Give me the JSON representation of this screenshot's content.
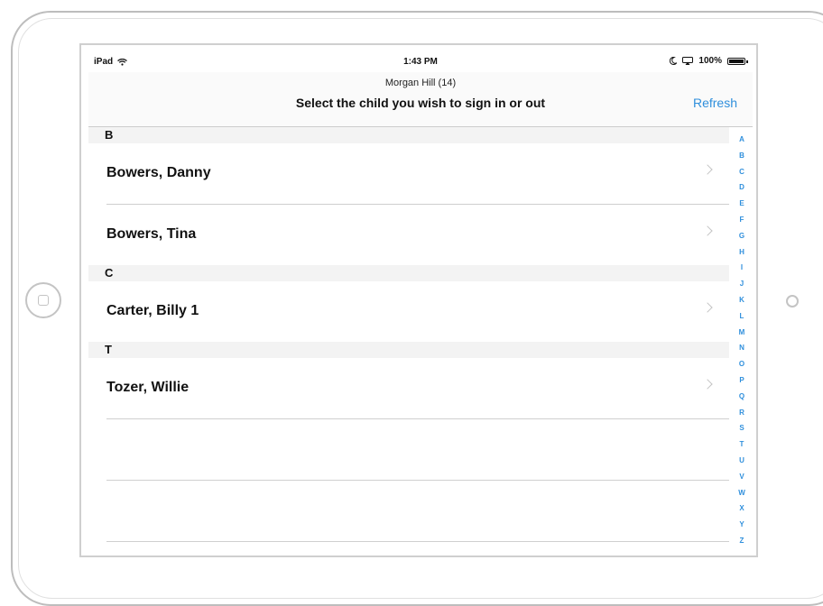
{
  "statusbar": {
    "device": "iPad",
    "wifi_icon": "wifi-icon",
    "time": "1:43 PM",
    "moon_icon": "moon-icon",
    "airplay_icon": "airplay-icon",
    "battery_text": "100%",
    "battery_level": 1.0
  },
  "navbar": {
    "subtitle": "Morgan Hill (14)",
    "title": "Select the child you wish to sign in or out",
    "refresh_label": "Refresh"
  },
  "sections": [
    {
      "letter": "B",
      "items": [
        {
          "name": "Bowers, Danny"
        },
        {
          "name": "Bowers, Tina"
        }
      ]
    },
    {
      "letter": "C",
      "items": [
        {
          "name": "Carter, Billy 1"
        }
      ]
    },
    {
      "letter": "T",
      "items": [
        {
          "name": "Tozer, Willie"
        }
      ]
    }
  ],
  "index_letters": [
    "A",
    "B",
    "C",
    "D",
    "E",
    "F",
    "G",
    "H",
    "I",
    "J",
    "K",
    "L",
    "M",
    "N",
    "O",
    "P",
    "Q",
    "R",
    "S",
    "T",
    "U",
    "V",
    "W",
    "X",
    "Y",
    "Z"
  ],
  "colors": {
    "accent": "#2f8fdc",
    "section_bg": "#f3f3f3",
    "separator": "#cfcfcf"
  }
}
